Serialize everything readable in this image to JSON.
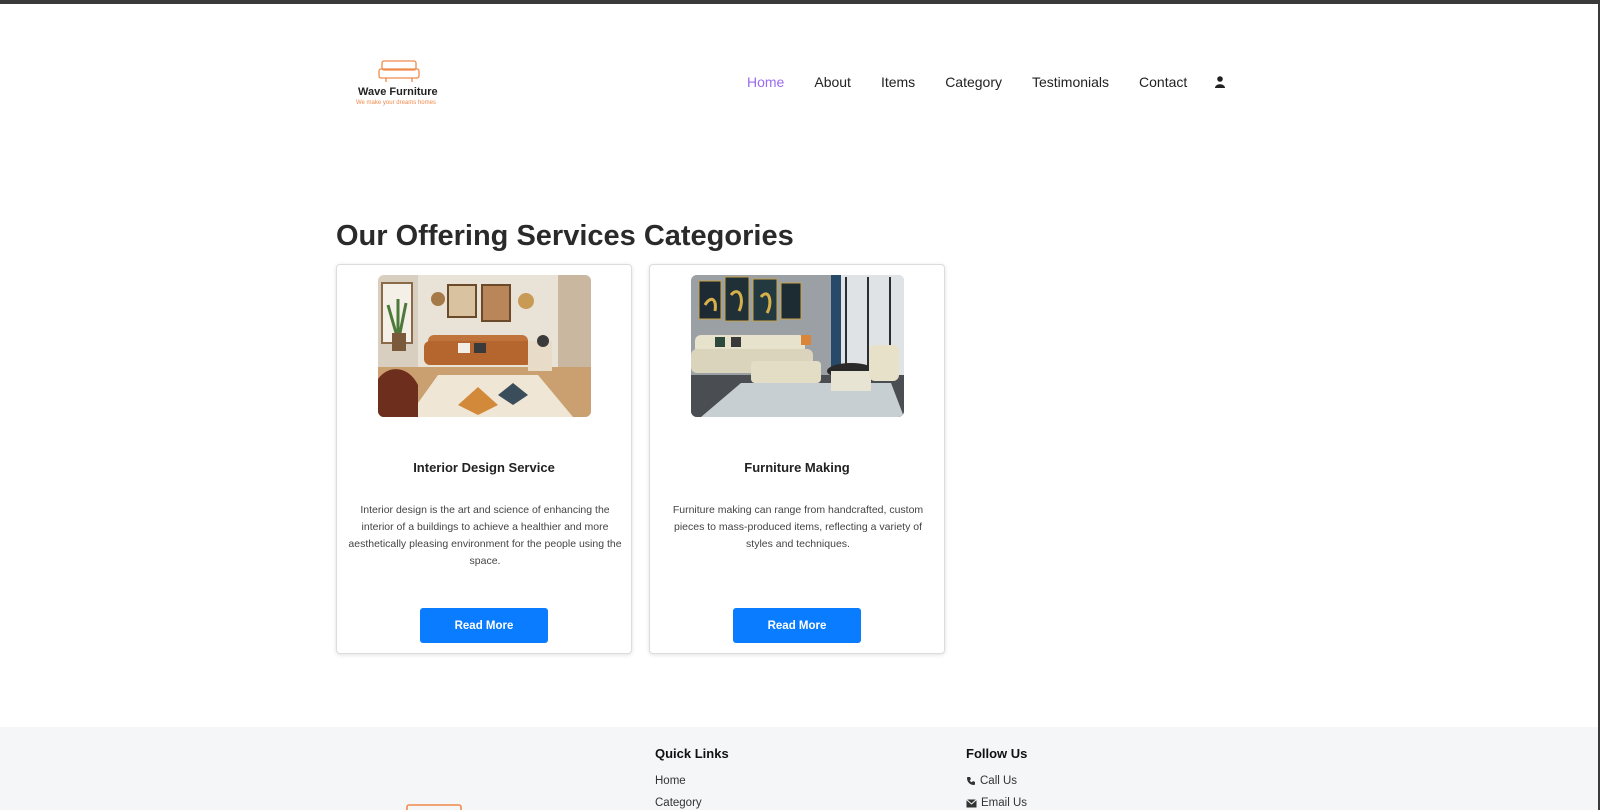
{
  "header": {
    "brand_name": "Wave Furniture",
    "brand_tagline": "We make your dreams homes",
    "nav": [
      {
        "label": "Home",
        "active": true
      },
      {
        "label": "About"
      },
      {
        "label": "Items"
      },
      {
        "label": "Category"
      },
      {
        "label": "Testimonials"
      },
      {
        "label": "Contact"
      }
    ],
    "user_icon": "user-icon"
  },
  "section": {
    "title": "Our Offering Services Categories",
    "cards": [
      {
        "title": "Interior Design Service",
        "text": "Interior design is the art and science of enhancing the interior of a buildings to achieve a healthier and more aesthetically pleasing environment for the people using the space.",
        "button": "Read More"
      },
      {
        "title": "Furniture Making",
        "text": "Furniture making can range from handcrafted, custom pieces to mass-produced items, reflecting a variety of styles and techniques.",
        "button": "Read More"
      }
    ]
  },
  "footer": {
    "quick_links": {
      "heading": "Quick Links",
      "links": [
        "Home",
        "Category"
      ]
    },
    "follow_us": {
      "heading": "Follow Us",
      "links": [
        {
          "label": "Call Us",
          "icon": "phone-icon"
        },
        {
          "label": "Email Us",
          "icon": "envelope-icon"
        }
      ]
    }
  },
  "colors": {
    "accent_nav": "#9b6cf0",
    "button": "#0a7cff",
    "logo_orange": "#f08a4b"
  }
}
